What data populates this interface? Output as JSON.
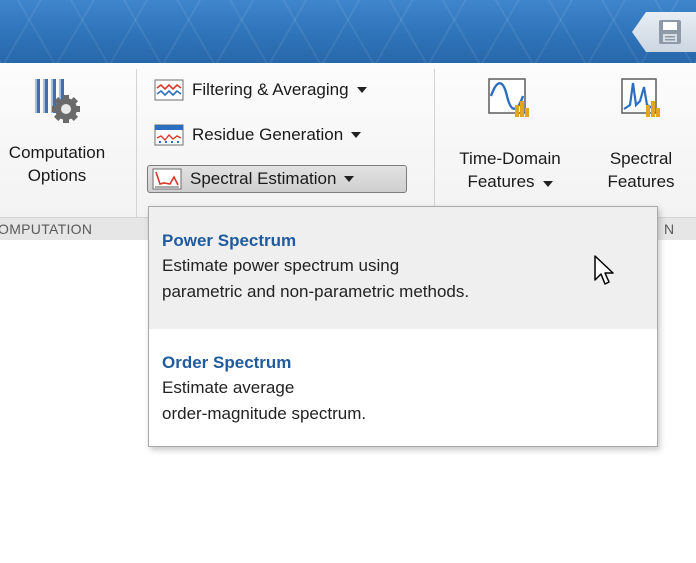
{
  "ribbon": {
    "computation_options": {
      "line1": "Computation",
      "line2": "Options",
      "section_label": "OMPUTATION"
    },
    "processing": {
      "filtering_averaging": "Filtering & Averaging",
      "residue_generation": "Residue Generation",
      "spectral_estimation": "Spectral Estimation"
    },
    "features": {
      "time_domain_line1": "Time-Domain",
      "time_domain_line2": "Features",
      "spectral_line1": "Spectral",
      "spectral_line2": "Features",
      "section_label_fragment": "N"
    }
  },
  "dropdown": {
    "items": [
      {
        "title": "Power Spectrum",
        "desc_line1": "Estimate power spectrum using",
        "desc_line2": "parametric and non-parametric methods."
      },
      {
        "title": "Order Spectrum",
        "desc_line1": "Estimate average",
        "desc_line2": "order-magnitude spectrum."
      }
    ]
  },
  "colors": {
    "titlebar": "#2f73b9",
    "menu_title": "#1f5b9e",
    "menu_hover": "#efefef"
  },
  "icons": {
    "quick_access": "save-icon",
    "computation": "gear-columns-icon",
    "filtering": "filter-waveform-icon",
    "residue": "residue-signal-icon",
    "spectral_estimation": "spectrum-icon",
    "time_domain": "time-domain-features-icon",
    "spectral_features": "spectral-features-icon"
  }
}
